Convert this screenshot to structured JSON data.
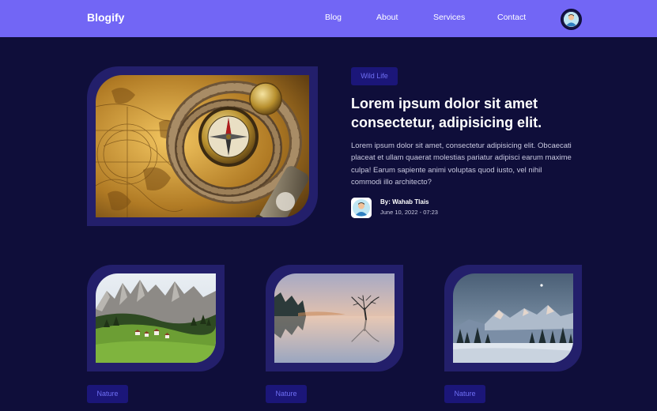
{
  "navbar": {
    "brand": "Blogify",
    "links": [
      "Blog",
      "About",
      "Services",
      "Contact"
    ],
    "color": "#7266f5"
  },
  "featured": {
    "tag": "Wild Life",
    "title": "Lorem ipsum dolor sit amet consectetur, adipisicing elit.",
    "excerpt": "Lorem ipsum dolor sit amet, consectetur adipisicing elit. Obcaecati placeat et ullam quaerat molestias pariatur adipisci earum maxime culpa! Earum sapiente animi voluptas quod iusto, vel nihil commodi illo architecto?",
    "author": "By: Wahab Tlais",
    "date": "June 10, 2022 - 07:23",
    "image": "compass-and-map"
  },
  "cards": [
    {
      "tag": "Nature",
      "image": "alpine-meadow-village"
    },
    {
      "tag": "Nature",
      "image": "lake-tree-sunset"
    },
    {
      "tag": "Nature",
      "image": "snowy-mountains"
    }
  ],
  "colors": {
    "background": "#0f0e3a",
    "frame": "#231f6b",
    "tag_bg": "#1b1679",
    "tag_text": "#6f6ff5"
  }
}
